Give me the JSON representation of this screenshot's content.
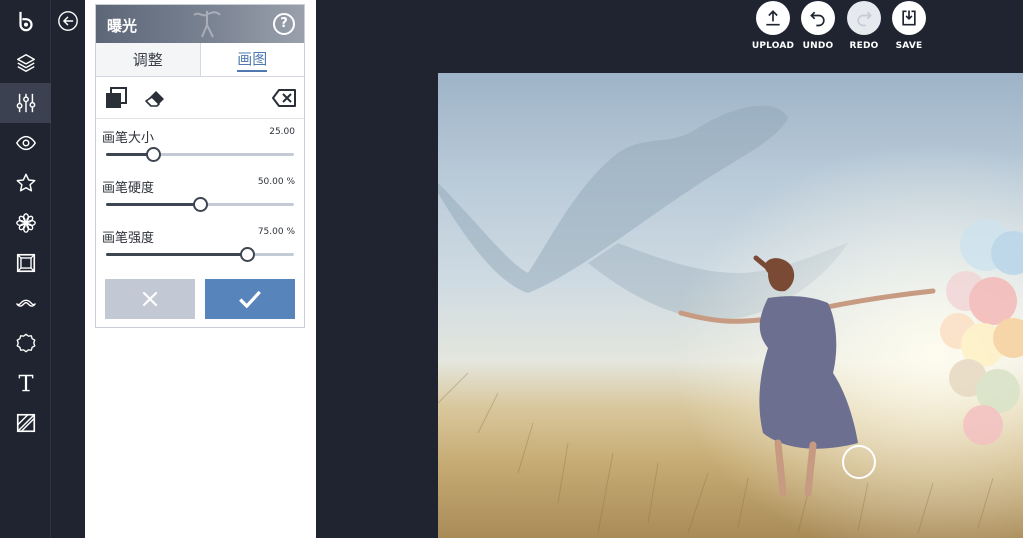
{
  "rail": {
    "items": [
      {
        "id": "logo",
        "icon": "logo-icon"
      },
      {
        "id": "layers",
        "icon": "layers-icon"
      },
      {
        "id": "adjust",
        "icon": "sliders-icon",
        "active": true
      },
      {
        "id": "view",
        "icon": "eye-icon"
      },
      {
        "id": "favorites",
        "icon": "star-icon"
      },
      {
        "id": "effects",
        "icon": "flower-icon"
      },
      {
        "id": "frames",
        "icon": "frame-icon"
      },
      {
        "id": "overlays",
        "icon": "mustache-icon"
      },
      {
        "id": "stickers",
        "icon": "badge-icon"
      },
      {
        "id": "text",
        "icon": "text-icon"
      },
      {
        "id": "textures",
        "icon": "texture-icon"
      }
    ]
  },
  "panel": {
    "title": "曝光",
    "help_label": "?",
    "tabs": [
      {
        "label": "调整",
        "active": false
      },
      {
        "label": "画图",
        "active": true
      }
    ],
    "tools": [
      "mask-icon",
      "eraser-icon",
      "clear-icon"
    ],
    "sliders": [
      {
        "label": "画笔大小",
        "value_text": "25.00",
        "fraction": 0.25
      },
      {
        "label": "画笔硬度",
        "value_text": "50.00 %",
        "fraction": 0.5
      },
      {
        "label": "画笔强度",
        "value_text": "75.00 %",
        "fraction": 0.75
      }
    ],
    "cancel_icon": "close-icon",
    "apply_icon": "check-icon"
  },
  "toolbar": {
    "upload": "UPLOAD",
    "undo": "UNDO",
    "redo": "REDO",
    "save": "SAVE"
  },
  "colors": {
    "background": "#1f2430",
    "accent": "#5784bb",
    "cancel": "#c2c8d4"
  }
}
